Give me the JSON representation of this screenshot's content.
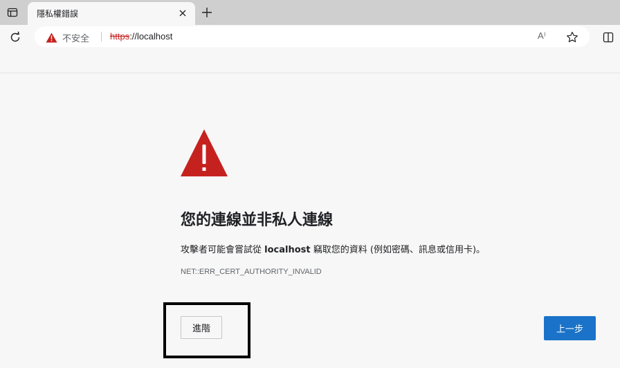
{
  "tab": {
    "title": "隱私權錯誤"
  },
  "address_bar": {
    "security_label": "不安全",
    "url_scheme": "https",
    "url_rest": "://localhost",
    "read_aloud_label": "A⁾"
  },
  "page": {
    "title": "您的連線並非私人連線",
    "desc_prefix": "攻擊者可能會嘗試從 ",
    "desc_host": "localhost",
    "desc_suffix": " 竊取您的資料 (例如密碼、訊息或信用卡)。",
    "error_code": "NET::ERR_CERT_AUTHORITY_INVALID",
    "advanced_label": "進階",
    "back_label": "上一步"
  },
  "colors": {
    "warning_red": "#c5221f",
    "primary_blue": "#1a73c8",
    "highlight_border": "#000000"
  },
  "icons": [
    "tab-actions-icon",
    "close-icon",
    "plus-icon",
    "reload-icon",
    "warning-icon",
    "read-aloud-icon",
    "star-icon",
    "split-screen-icon"
  ]
}
